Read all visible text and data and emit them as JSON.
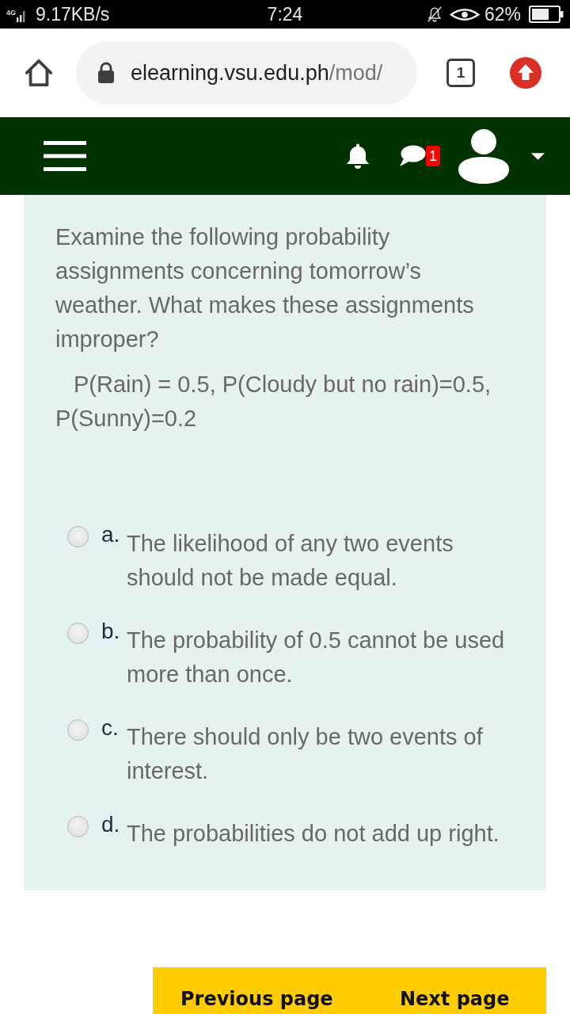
{
  "status_bar": {
    "network": "4G",
    "speed": "9.17KB/s",
    "time": "7:24",
    "battery": "62%"
  },
  "browser": {
    "url_host": "elearning.vsu.edu.ph",
    "url_path": "/mod/",
    "tab_count": "1"
  },
  "navbar": {
    "message_badge": "1"
  },
  "question": {
    "text": "Examine the following probability assignments concerning tomorrow’s weather. What makes these assignments improper?",
    "formula": "P(Rain) = 0.5, P(Cloudy but no rain)=0.5, P(Sunny)=0.2",
    "options": [
      {
        "letter": "a.",
        "text": "The likelihood of any two events should not be made equal.",
        "selected": false
      },
      {
        "letter": "b.",
        "text": "The probability of 0.5 cannot be used more than once.",
        "selected": false
      },
      {
        "letter": "c.",
        "text": "There should only be two events of interest.",
        "selected": false
      },
      {
        "letter": "d.",
        "text": "The probabilities do not add up right.",
        "selected": false
      }
    ]
  },
  "navigation": {
    "buttons": [
      {
        "kind": "previous",
        "label": "Previous page"
      },
      {
        "kind": "next",
        "label": "Next page"
      }
    ]
  }
}
